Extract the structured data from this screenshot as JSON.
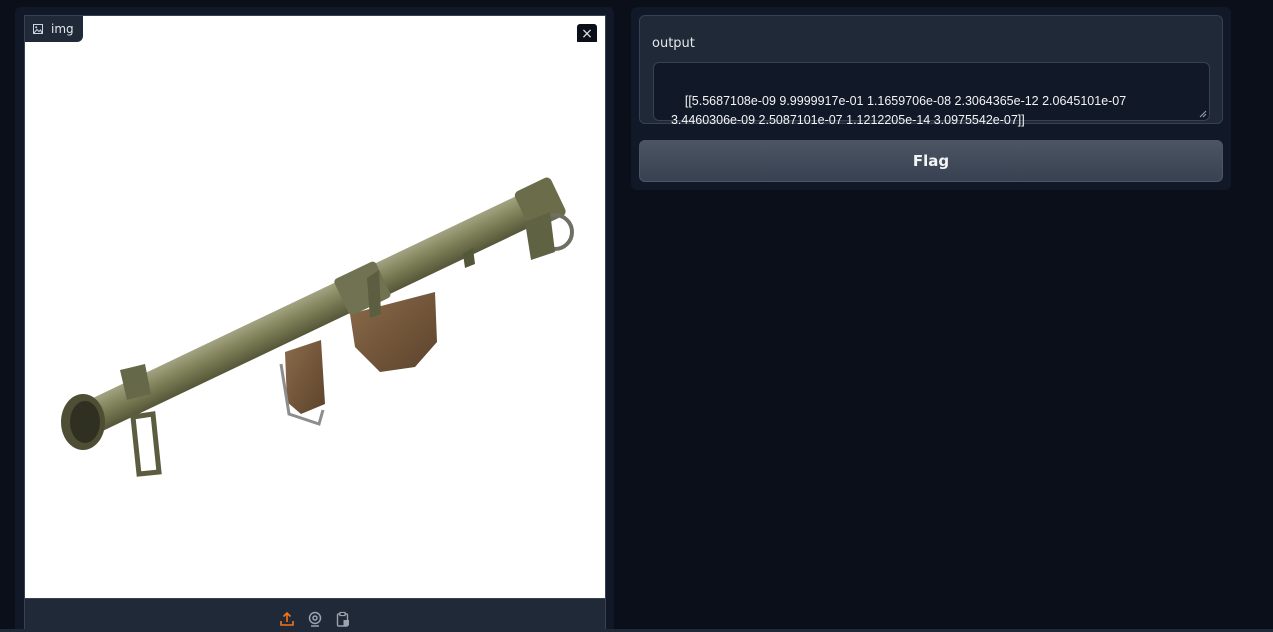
{
  "image_input": {
    "label": "img",
    "label_icon": "image-icon",
    "close_icon": "close-icon",
    "close_symbol": "×",
    "picture_description_icon": "bazooka-image",
    "toolbar": [
      {
        "name": "upload-icon",
        "color": "#f97316"
      },
      {
        "name": "webcam-icon",
        "color": "#9ca3af"
      },
      {
        "name": "clipboard-icon",
        "color": "#9ca3af"
      }
    ]
  },
  "output": {
    "label": "output",
    "value": "[[5.5687108e-09 9.9999917e-01 1.1659706e-08 2.3064365e-12 2.0645101e-07\n  3.4460306e-09 2.5087101e-07 1.1212205e-14 3.0975542e-07]]"
  },
  "flag_button": {
    "label": "Flag"
  },
  "colors": {
    "background": "#0b0f19",
    "panel": "#111827",
    "block": "#1f2937",
    "border": "#374151",
    "accent": "#f97316"
  }
}
